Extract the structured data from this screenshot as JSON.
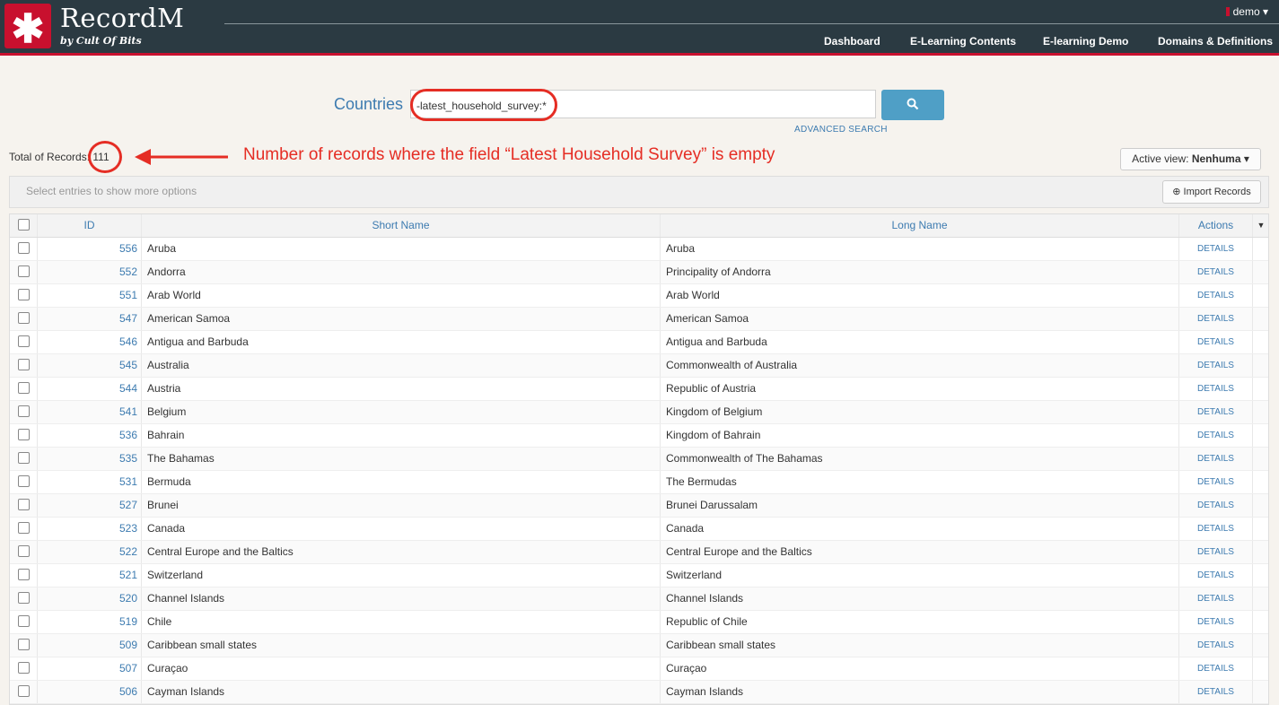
{
  "brand": {
    "name": "RecordM",
    "subtitle": "by Cult Of Bits",
    "logo_icon": "asterisk-icon"
  },
  "user": {
    "name": "demo"
  },
  "nav": [
    "Dashboard",
    "E-Learning Contents",
    "E-learning Demo",
    "Domains & Definitions"
  ],
  "search": {
    "entity": "Countries",
    "query": "-latest_household_survey:*",
    "button_icon": "search-icon",
    "advanced_label": "ADVANCED SEARCH"
  },
  "total": {
    "label": "Total of Records:",
    "count": "111"
  },
  "annotation": {
    "text": "Number of records where the field “Latest Household Survey” is empty"
  },
  "view": {
    "label": "Active view:",
    "value": "Nenhuma"
  },
  "toolbar": {
    "hint": "Select entries to show more options",
    "import_label": "Import Records"
  },
  "table": {
    "columns": [
      "ID",
      "Short Name",
      "Long Name",
      "Actions"
    ],
    "action_label": "DETAILS",
    "rows": [
      {
        "id": "556",
        "short": "Aruba",
        "long": "Aruba"
      },
      {
        "id": "552",
        "short": "Andorra",
        "long": "Principality of Andorra"
      },
      {
        "id": "551",
        "short": "Arab World",
        "long": "Arab World"
      },
      {
        "id": "547",
        "short": "American Samoa",
        "long": "American Samoa"
      },
      {
        "id": "546",
        "short": "Antigua and Barbuda",
        "long": "Antigua and Barbuda"
      },
      {
        "id": "545",
        "short": "Australia",
        "long": "Commonwealth of Australia"
      },
      {
        "id": "544",
        "short": "Austria",
        "long": "Republic of Austria"
      },
      {
        "id": "541",
        "short": "Belgium",
        "long": "Kingdom of Belgium"
      },
      {
        "id": "536",
        "short": "Bahrain",
        "long": "Kingdom of Bahrain"
      },
      {
        "id": "535",
        "short": "The Bahamas",
        "long": "Commonwealth of The Bahamas"
      },
      {
        "id": "531",
        "short": "Bermuda",
        "long": "The Bermudas"
      },
      {
        "id": "527",
        "short": "Brunei",
        "long": "Brunei Darussalam"
      },
      {
        "id": "523",
        "short": "Canada",
        "long": "Canada"
      },
      {
        "id": "522",
        "short": "Central Europe and the Baltics",
        "long": "Central Europe and the Baltics"
      },
      {
        "id": "521",
        "short": "Switzerland",
        "long": "Switzerland"
      },
      {
        "id": "520",
        "short": "Channel Islands",
        "long": "Channel Islands"
      },
      {
        "id": "519",
        "short": "Chile",
        "long": "Republic of Chile"
      },
      {
        "id": "509",
        "short": "Caribbean small states",
        "long": "Caribbean small states"
      },
      {
        "id": "507",
        "short": "Curaçao",
        "long": "Curaçao"
      },
      {
        "id": "506",
        "short": "Cayman Islands",
        "long": "Cayman Islands"
      }
    ]
  },
  "colors": {
    "header_bg": "#2b3a42",
    "brand_red": "#c8102e",
    "link_blue": "#3d7bb0",
    "annotation_red": "#e52d24"
  }
}
